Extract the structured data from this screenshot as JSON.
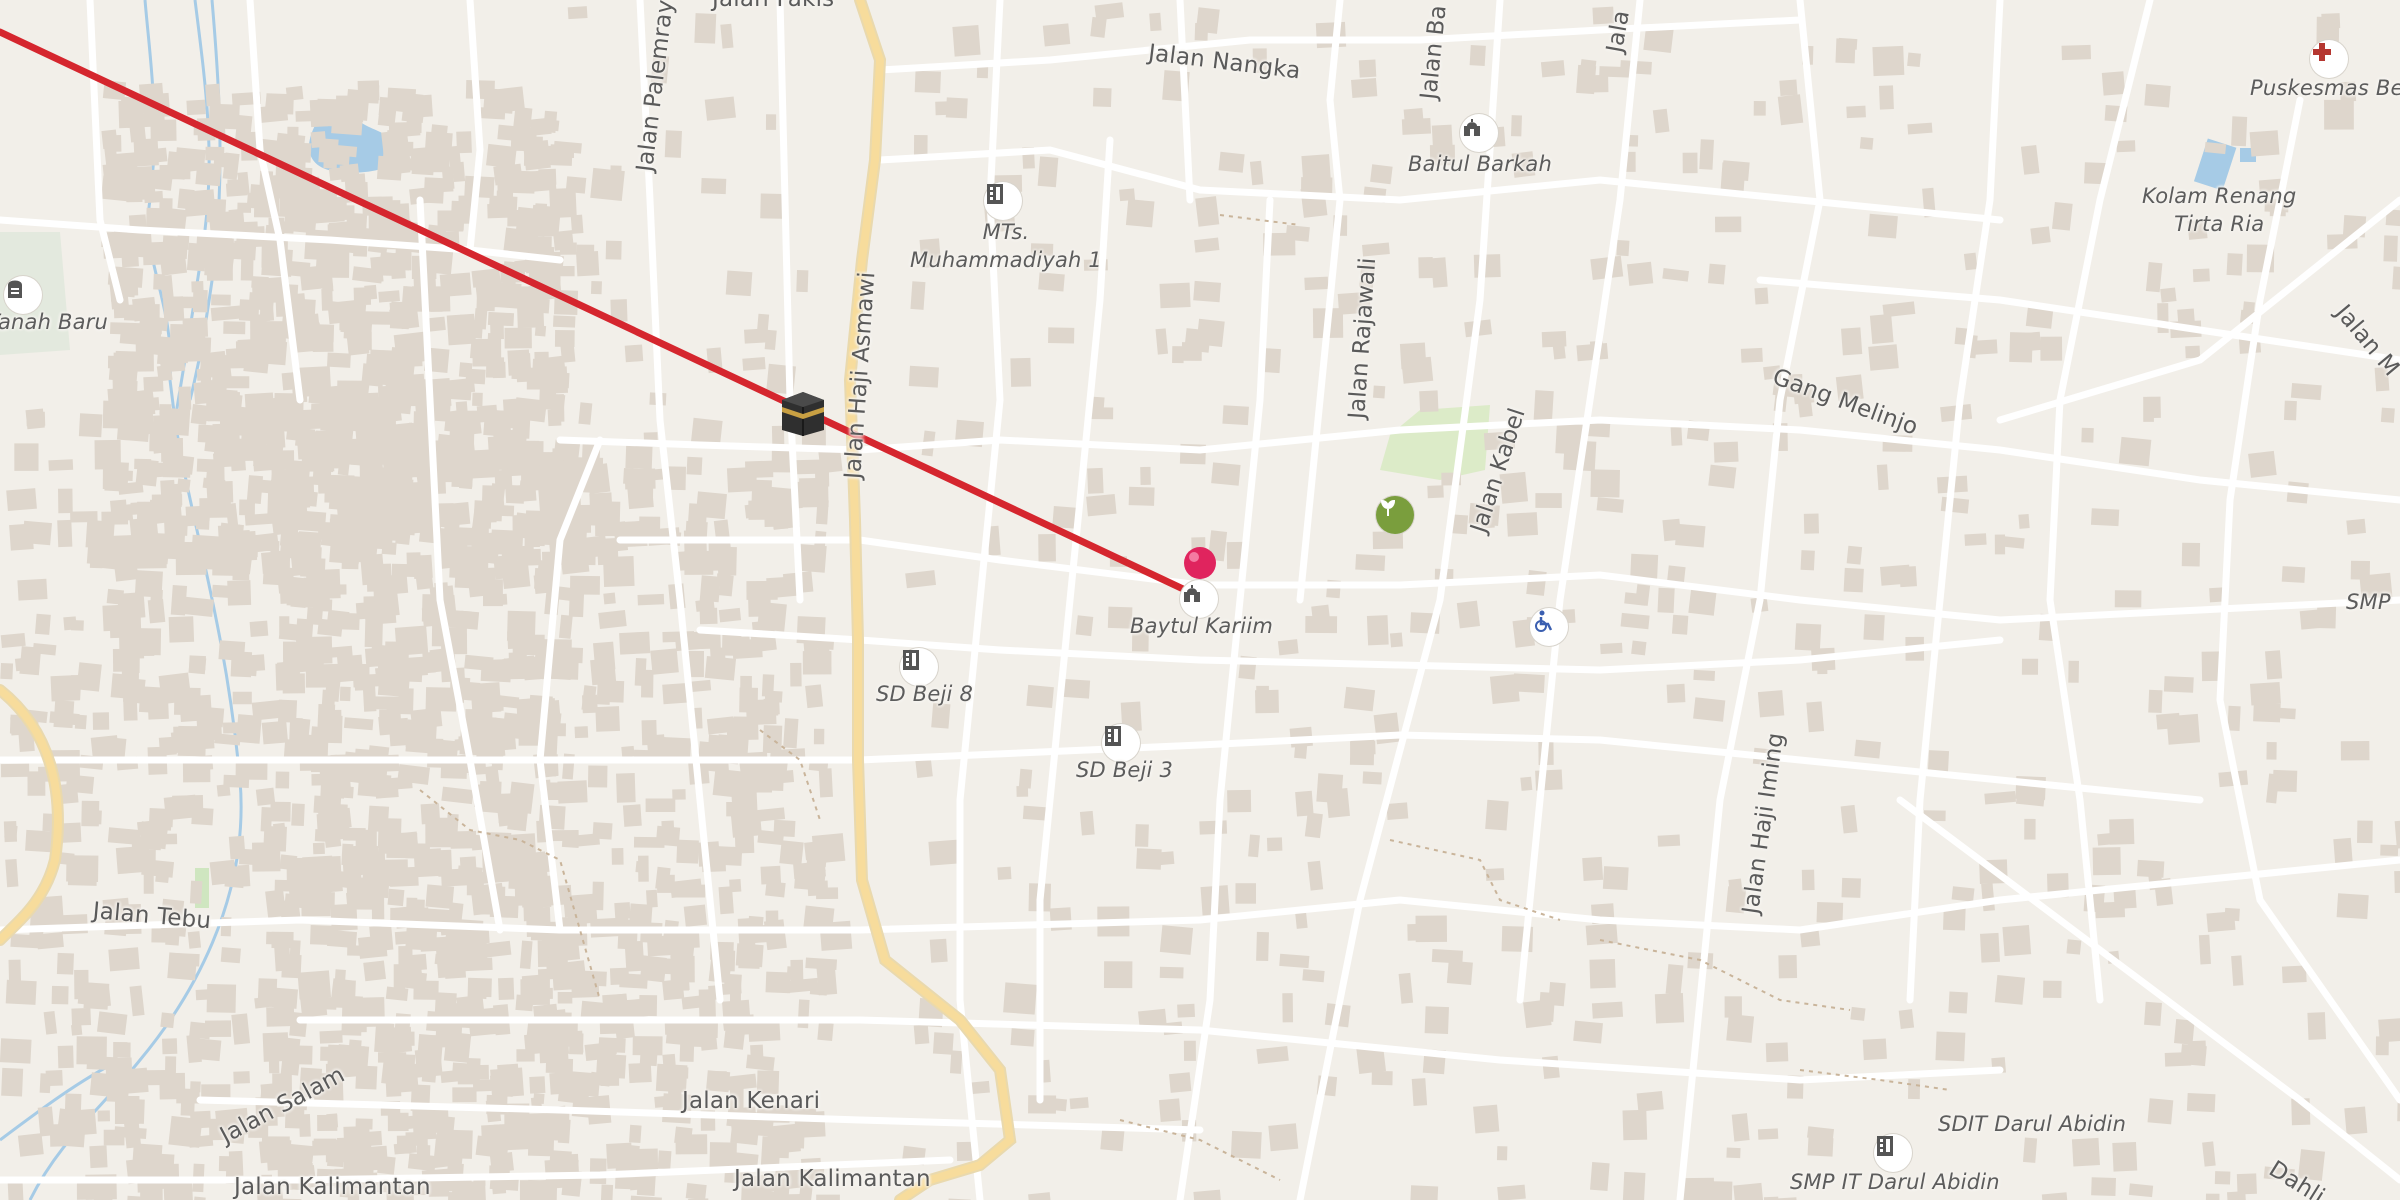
{
  "map": {
    "route_color": "#d5262e",
    "pin_color": "#e0245e",
    "road_color": "#ffffff",
    "major_road_color": "#f6d58d",
    "building_color": "#ded6cc",
    "water_color": "#a6cbe6",
    "park_color": "#dcebc8"
  },
  "streets": {
    "fakis": "Jalan Fakis",
    "nangka": "Jalan Nangka",
    "palemraya": "Jalan Palemraya",
    "haji_asmawi": "Jalan Haji Asmawi",
    "rajawali": "Jalan Rajawali",
    "kabel": "Jalan Kabel",
    "ba_top": "Jalan Ba",
    "jala_top": "Jala",
    "gang_melinjo": "Gang Melinjo",
    "jalan_right": "Jalan M",
    "haji_iming": "Jalan Haji Iming",
    "tebu": "Jalan Tebu",
    "salam": "Jalan Salam",
    "kenari": "Jalan Kenari",
    "kalimantan_left": "Jalan Kalimantan",
    "kalimantan_mid": "Jalan Kalimantan",
    "dahli": "Dahli"
  },
  "pois": {
    "puskesmas": "Puskesmas Beji",
    "kolam_line1": "Kolam Renang",
    "kolam_line2": "Tirta Ria",
    "baitul_barkah": "Baitul Barkah",
    "mts_line1": "MTs.",
    "mts_line2": "Muhammadiyah 1",
    "tanah_baru": "Tanah Baru",
    "baytul_kariim": "Baytul Kariim",
    "sd_beji_8": "SD Beji 8",
    "sd_beji_3": "SD Beji 3",
    "smp_right": "SMP",
    "sdit": "SDIT Darul Abidin",
    "smp_it": "SMP IT Darul Abidin"
  },
  "icons": {
    "kaaba": "kaaba-icon",
    "pin": "location-pin-icon",
    "mosque": "mosque-icon",
    "school": "school-icon",
    "hospital": "hospital-cross-icon",
    "cemetery": "cemetery-icon",
    "garden": "garden-icon",
    "disability": "wheelchair-icon"
  }
}
